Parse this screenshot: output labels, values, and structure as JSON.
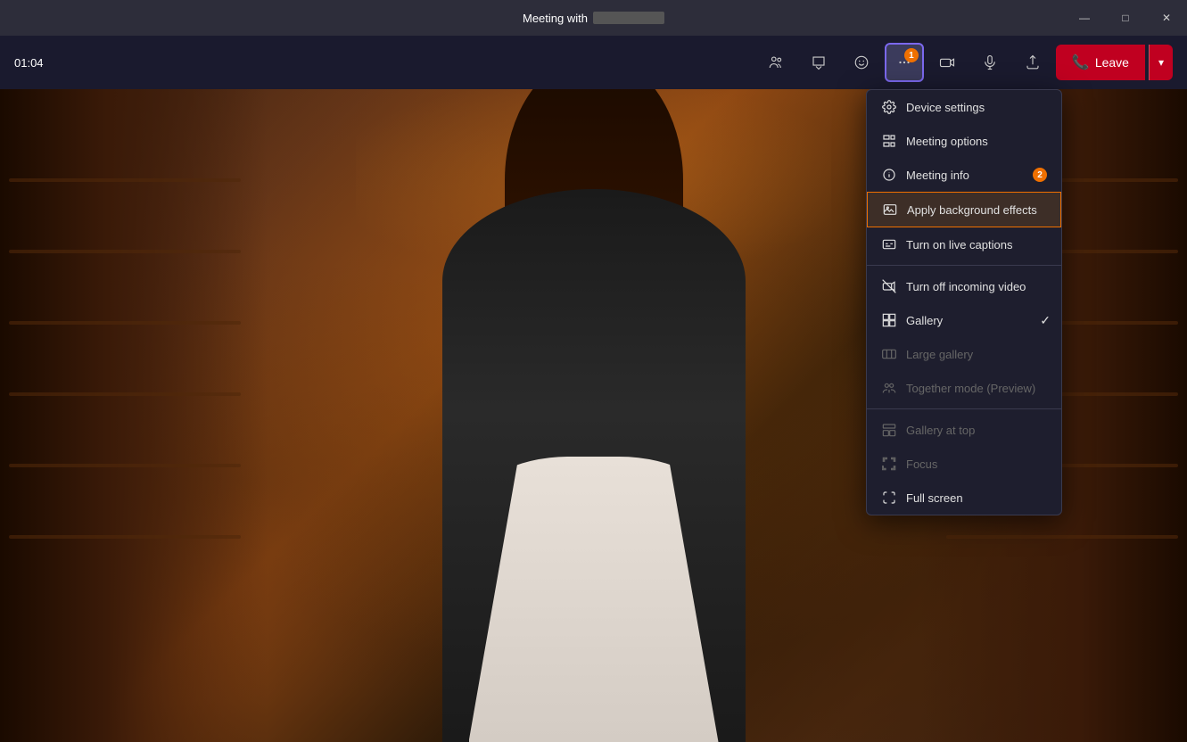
{
  "titleBar": {
    "title": "Meeting with",
    "redacted": true,
    "controls": {
      "minimize": "—",
      "maximize": "□",
      "close": "✕"
    }
  },
  "toolbar": {
    "timer": "01:04",
    "buttons": [
      {
        "id": "participants",
        "label": "Participants",
        "icon": "people"
      },
      {
        "id": "chat",
        "label": "Chat",
        "icon": "chat"
      },
      {
        "id": "reactions",
        "label": "Reactions",
        "icon": "emoji"
      },
      {
        "id": "more",
        "label": "More options",
        "icon": "ellipsis",
        "active": true,
        "badge": "1"
      },
      {
        "id": "camera",
        "label": "Camera",
        "icon": "camera"
      },
      {
        "id": "mic",
        "label": "Microphone",
        "icon": "mic"
      },
      {
        "id": "share",
        "label": "Share",
        "icon": "share"
      }
    ],
    "leaveButton": "Leave",
    "leaveDropdown": "▾"
  },
  "contextMenu": {
    "items": [
      {
        "id": "device-settings",
        "label": "Device settings",
        "icon": "gear",
        "disabled": false,
        "highlighted": false
      },
      {
        "id": "meeting-options",
        "label": "Meeting options",
        "icon": "options",
        "disabled": false,
        "highlighted": false
      },
      {
        "id": "meeting-info",
        "label": "Meeting info",
        "icon": "info",
        "disabled": false,
        "highlighted": false,
        "badge": "2"
      },
      {
        "id": "apply-background",
        "label": "Apply background effects",
        "icon": "background",
        "disabled": false,
        "highlighted": true
      },
      {
        "id": "live-captions",
        "label": "Turn on live captions",
        "icon": "captions",
        "disabled": false,
        "highlighted": false
      },
      {
        "id": "divider1",
        "type": "divider"
      },
      {
        "id": "turn-off-video",
        "label": "Turn off incoming video",
        "icon": "video-off",
        "disabled": false,
        "highlighted": false
      },
      {
        "id": "gallery",
        "label": "Gallery",
        "icon": "gallery",
        "disabled": false,
        "highlighted": false,
        "check": true
      },
      {
        "id": "large-gallery",
        "label": "Large gallery",
        "icon": "large-gallery",
        "disabled": true,
        "highlighted": false
      },
      {
        "id": "together-mode",
        "label": "Together mode (Preview)",
        "icon": "together",
        "disabled": true,
        "highlighted": false
      },
      {
        "id": "divider2",
        "type": "divider"
      },
      {
        "id": "gallery-top",
        "label": "Gallery at top",
        "icon": "gallery-top",
        "disabled": true,
        "highlighted": false
      },
      {
        "id": "focus",
        "label": "Focus",
        "icon": "focus",
        "disabled": true,
        "highlighted": false
      },
      {
        "id": "full-screen",
        "label": "Full screen",
        "icon": "fullscreen",
        "disabled": false,
        "highlighted": false
      }
    ]
  }
}
